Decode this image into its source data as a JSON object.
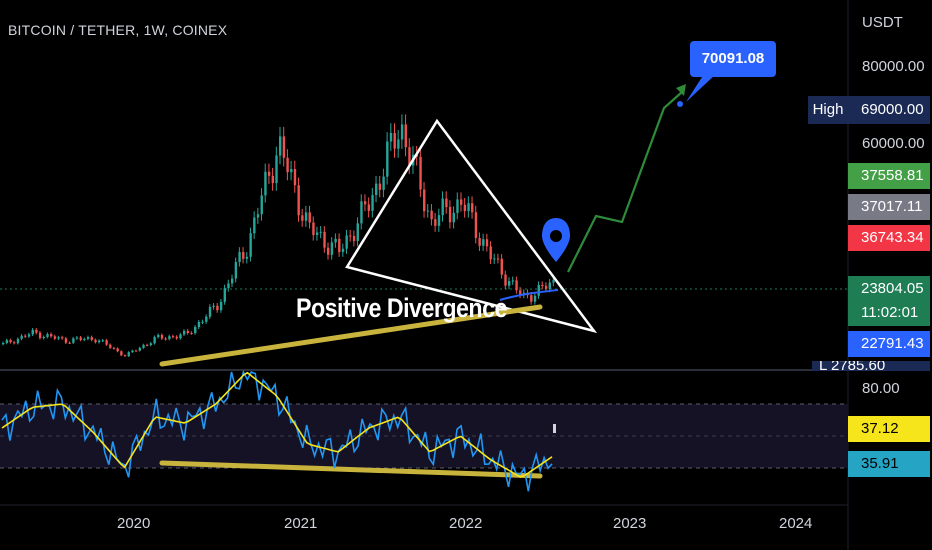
{
  "title": "BITCOIN / TETHER, 1W, COINEX",
  "axis_unit": "USDT",
  "price_ticks": [
    "80000.00",
    "60000.00"
  ],
  "rsi_tick": "80.00",
  "high_label": "High",
  "high_value": "69000.00",
  "target_value": "70091.08",
  "annotation": "Positive Divergence",
  "badges": [
    {
      "text": "37558.81",
      "color": "#43a047"
    },
    {
      "text": "37017.11",
      "color": "#787b86"
    },
    {
      "text": "36743.34",
      "color": "#f23645"
    },
    {
      "text": "23804.05",
      "color": "#1e7d53"
    },
    {
      "text": "11:02:01",
      "color": "#1e7d53"
    },
    {
      "text": "22791.43",
      "color": "#2962ff"
    }
  ],
  "rsi_badges": [
    {
      "text": "37.12",
      "color": "#f7e51b"
    },
    {
      "text": "35.91",
      "color": "#26a4c4"
    }
  ],
  "clipped_text": "L 2785.60",
  "years": [
    "2020",
    "2021",
    "2022",
    "2023",
    "2024"
  ],
  "colors": {
    "up": "#26a69a",
    "down": "#ef5350",
    "rsi": "#2196f3",
    "rsi_ma": "#f7e51b",
    "trendline": "#c8b43c",
    "projection": "#2e8b3a",
    "target": "#2962ff"
  },
  "chart_data": [
    {
      "type": "candlestick",
      "title": "BITCOIN / TETHER, 1W, COINEX",
      "ylabel": "USDT",
      "x": [
        "2019-05",
        "2019-07",
        "2019-10",
        "2020-01",
        "2020-03",
        "2020-06",
        "2020-09",
        "2020-11",
        "2021-01",
        "2021-04",
        "2021-05",
        "2021-07",
        "2021-09",
        "2021-11",
        "2022-01",
        "2022-03",
        "2022-05",
        "2022-06",
        "2022-07"
      ],
      "close": [
        8000,
        11000,
        9000,
        9500,
        5000,
        9500,
        10500,
        18000,
        34000,
        60000,
        38000,
        32000,
        45000,
        65000,
        40000,
        45000,
        30000,
        20000,
        23800
      ],
      "high": 69000,
      "annotations": [
        "Positive Divergence"
      ],
      "target": 70091.08
    },
    {
      "type": "line",
      "series": [
        {
          "values": [
            55,
            68,
            70,
            52,
            30,
            62,
            58,
            70,
            90,
            75,
            45,
            40,
            55,
            62,
            40,
            50,
            35,
            24,
            37
          ]
        }
      ],
      "ylim": [
        20,
        90
      ],
      "levels": [
        70,
        50,
        30
      ],
      "rsi": 35.91,
      "rsi_ma": 37.12
    }
  ]
}
